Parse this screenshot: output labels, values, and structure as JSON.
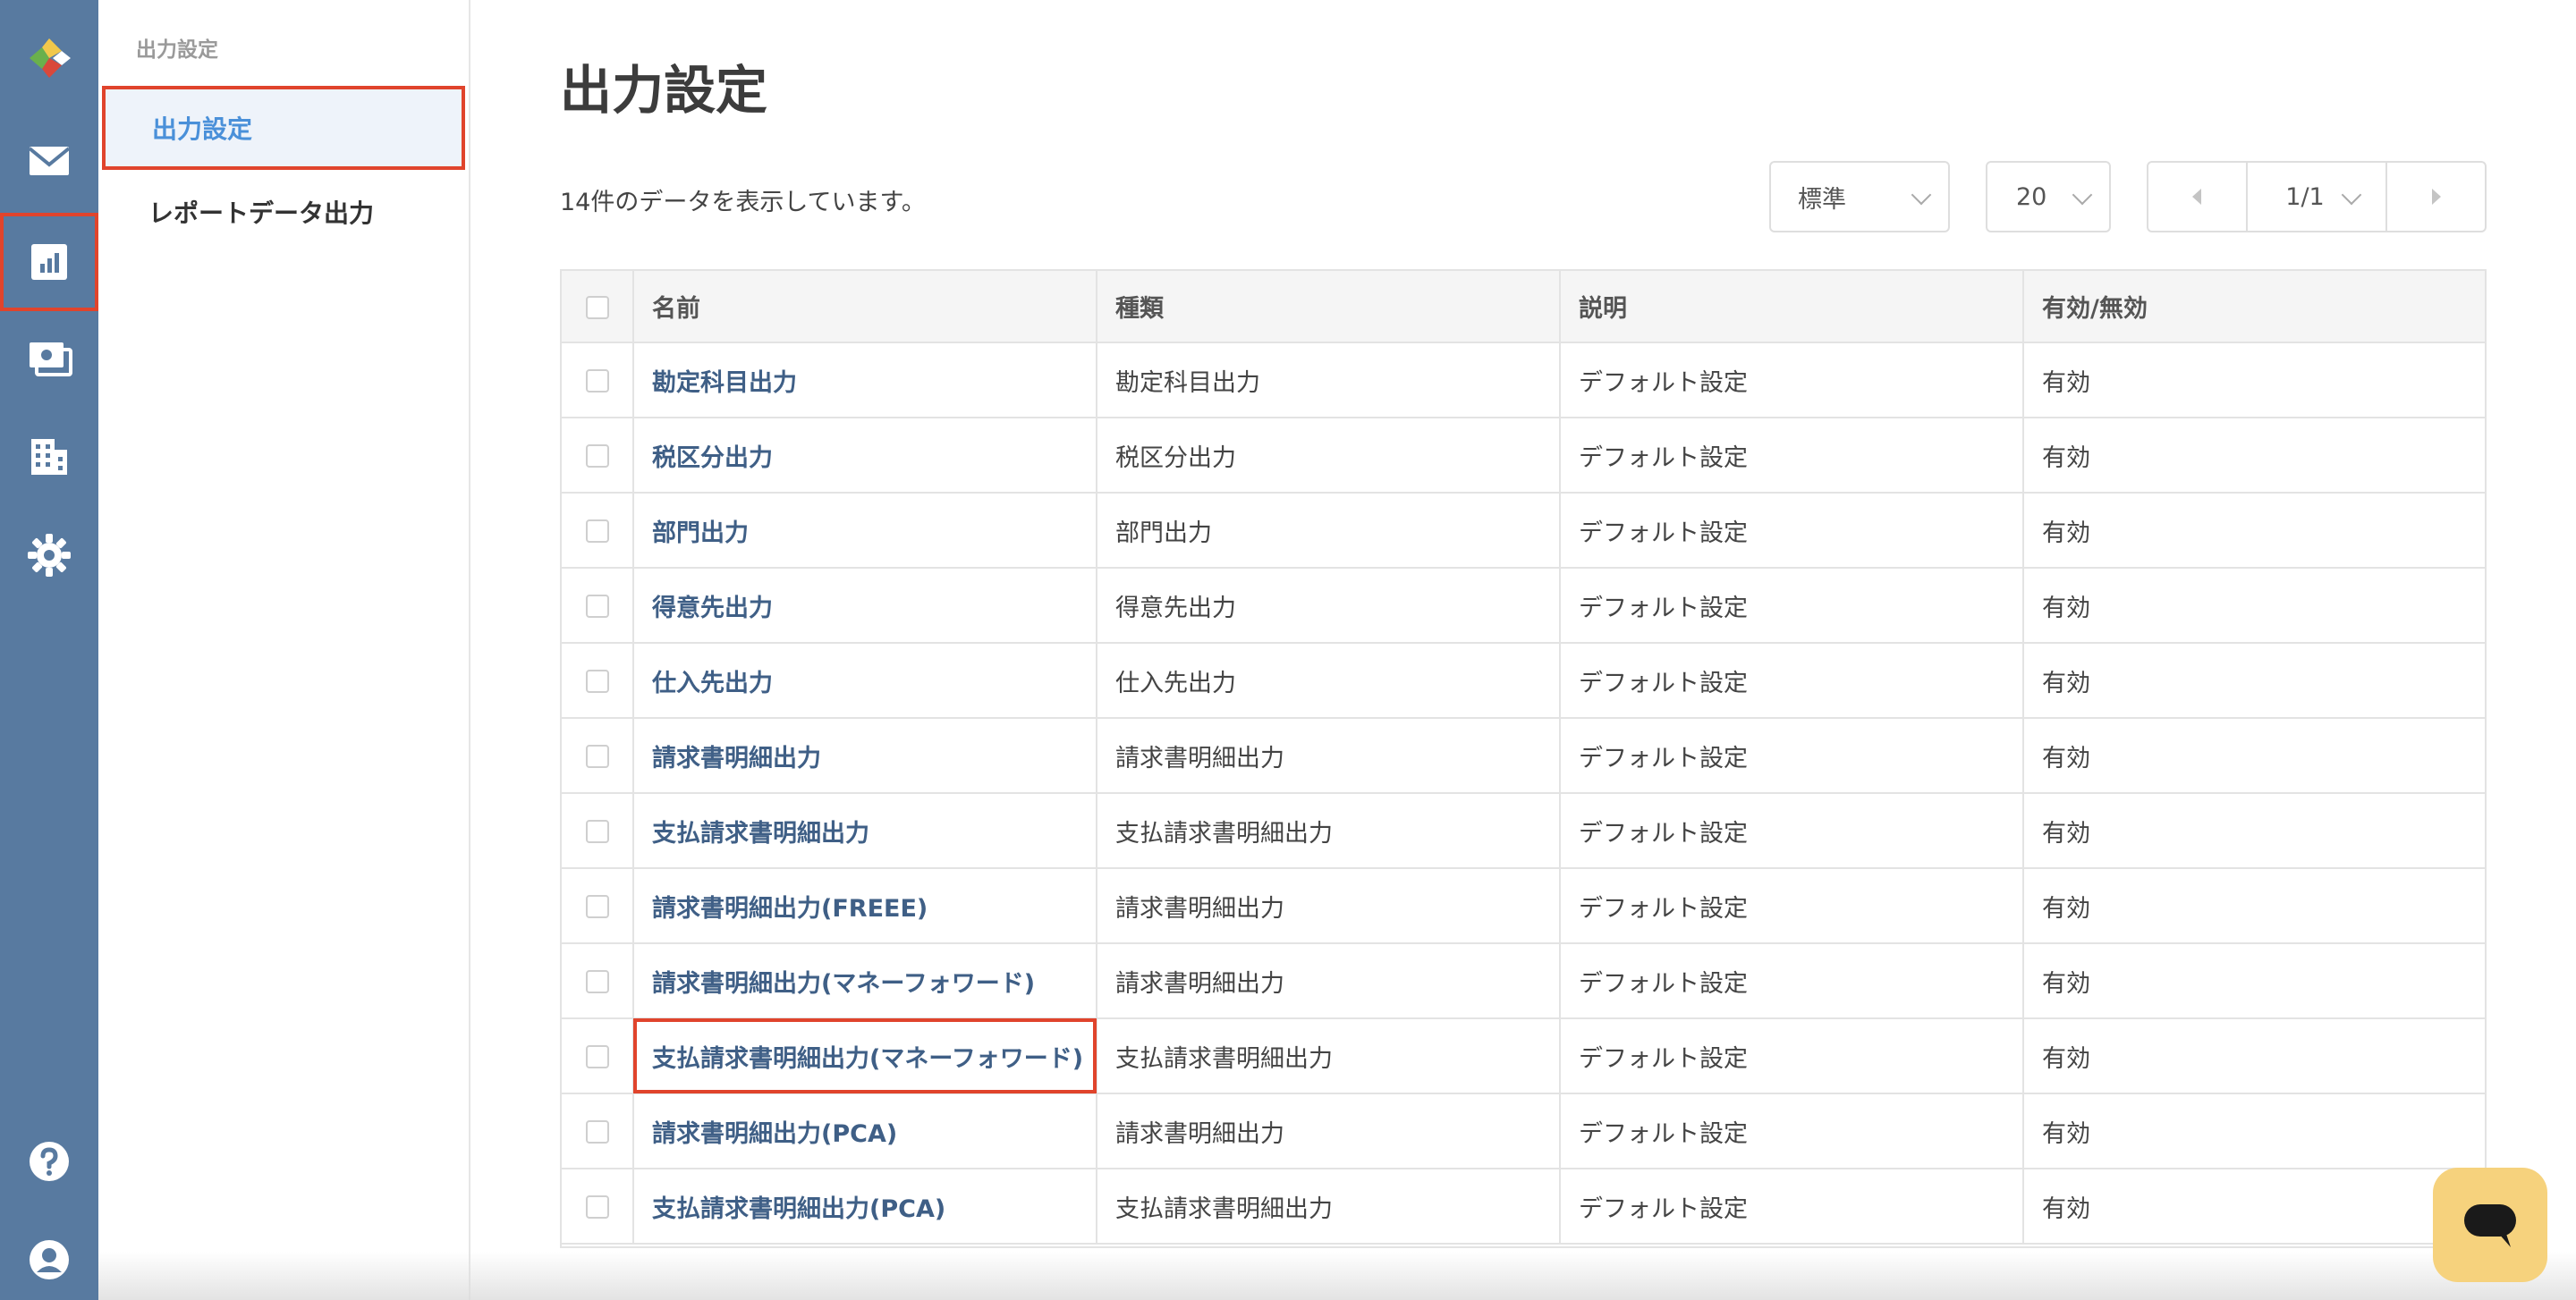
{
  "sidebar_rail": {
    "items": [
      {
        "icon": "app-logo-icon"
      },
      {
        "icon": "mail-icon"
      },
      {
        "icon": "report-chart-icon",
        "highlighted": true
      },
      {
        "icon": "invoice-money-icon"
      },
      {
        "icon": "building-icon"
      },
      {
        "icon": "gear-icon"
      },
      {
        "icon": "help-icon"
      },
      {
        "icon": "user-account-icon"
      }
    ],
    "background": "#587aa0",
    "highlight_color": "#e0442c"
  },
  "subnav": {
    "section_label": "出力設定",
    "items": [
      {
        "label": "出力設定",
        "active": true
      },
      {
        "label": "レポートデータ出力",
        "active": false
      }
    ]
  },
  "main": {
    "title": "出力設定",
    "record_count": "14件のデータを表示しています。",
    "view_select": "標準",
    "per_page_select": "20",
    "pagination": {
      "current": "1/1"
    }
  },
  "table": {
    "columns": [
      "名前",
      "種類",
      "説明",
      "有効/無効"
    ],
    "rows": [
      {
        "name": "勘定科目出力",
        "type": "勘定科目出力",
        "description": "デフォルト設定",
        "status": "有効"
      },
      {
        "name": "税区分出力",
        "type": "税区分出力",
        "description": "デフォルト設定",
        "status": "有効"
      },
      {
        "name": "部門出力",
        "type": "部門出力",
        "description": "デフォルト設定",
        "status": "有効"
      },
      {
        "name": "得意先出力",
        "type": "得意先出力",
        "description": "デフォルト設定",
        "status": "有効"
      },
      {
        "name": "仕入先出力",
        "type": "仕入先出力",
        "description": "デフォルト設定",
        "status": "有効"
      },
      {
        "name": "請求書明細出力",
        "type": "請求書明細出力",
        "description": "デフォルト設定",
        "status": "有効"
      },
      {
        "name": "支払請求書明細出力",
        "type": "支払請求書明細出力",
        "description": "デフォルト設定",
        "status": "有効"
      },
      {
        "name": "請求書明細出力(FREEE)",
        "type": "請求書明細出力",
        "description": "デフォルト設定",
        "status": "有効"
      },
      {
        "name": "請求書明細出力(マネーフォワード)",
        "type": "請求書明細出力",
        "description": "デフォルト設定",
        "status": "有効"
      },
      {
        "name": "支払請求書明細出力(マネーフォワード)",
        "type": "支払請求書明細出力",
        "description": "デフォルト設定",
        "status": "有効",
        "highlighted": true
      },
      {
        "name": "請求書明細出力(PCA)",
        "type": "請求書明細出力",
        "description": "デフォルト設定",
        "status": "有効"
      },
      {
        "name": "支払請求書明細出力(PCA)",
        "type": "支払請求書明細出力",
        "description": "デフォルト設定",
        "status": "有効"
      }
    ]
  },
  "colors": {
    "link_name": "#3f5f86",
    "active_subnav_text": "#4a90d9",
    "chat_button": "#f6d27d"
  },
  "chat": {
    "icon": "chat-bubble-icon"
  }
}
